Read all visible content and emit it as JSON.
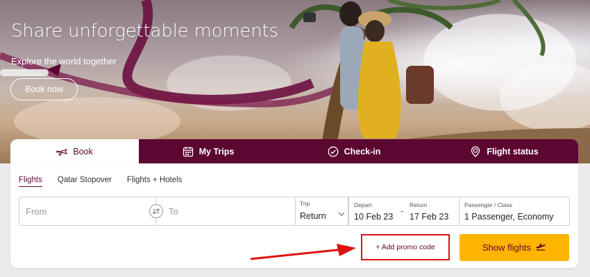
{
  "hero": {
    "title": "Share unforgettable moments",
    "subtitle": "Explore the world together",
    "cta_label": "Book now"
  },
  "tabs": [
    {
      "label": "Book",
      "icon": "plane-icon",
      "active": true
    },
    {
      "label": "My Trips",
      "icon": "calendar-icon",
      "active": false
    },
    {
      "label": "Check-in",
      "icon": "check-circle-icon",
      "active": false
    },
    {
      "label": "Flight status",
      "icon": "location-pin-icon",
      "active": false
    }
  ],
  "subtabs": [
    {
      "label": "Flights",
      "active": true
    },
    {
      "label": "Qatar Stopover",
      "active": false
    },
    {
      "label": "Flights + Hotels",
      "active": false
    }
  ],
  "search": {
    "from_placeholder": "From",
    "to_placeholder": "To",
    "trip_label": "Trip",
    "trip_value": "Return",
    "depart_label": "Depart",
    "depart_value": "10 Feb 23",
    "date_separator": "-",
    "return_label": "Return",
    "return_value": "17 Feb 23",
    "pax_label": "Passenger / Class",
    "pax_value": "1 Passenger, Economy"
  },
  "actions": {
    "promo_label": "+ Add promo code",
    "show_flights_label": "Show flights"
  },
  "colors": {
    "brand": "#5c0632",
    "cta": "#ffb400",
    "annotation": "#e01010"
  }
}
